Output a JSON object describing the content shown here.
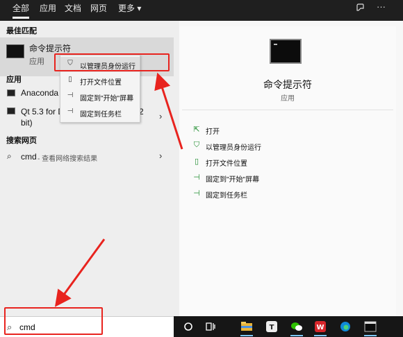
{
  "tabs": [
    {
      "label": "全部",
      "active": true
    },
    {
      "label": "应用",
      "active": false
    },
    {
      "label": "文档",
      "active": false
    },
    {
      "label": "网页",
      "active": false
    },
    {
      "label": "更多 ▾",
      "active": false
    }
  ],
  "top_icons": {
    "feedback": "♪",
    "more": "···"
  },
  "left": {
    "best_match_title": "最佳匹配",
    "best_match": {
      "name": "命令提示符",
      "type": "应用"
    },
    "apps_title": "应用",
    "apps": [
      {
        "name": "Anaconda"
      },
      {
        "name_line1": "Qt 5.3 for D",
        "name_line1_suffix": "2",
        "name_line2": "bit)"
      }
    ],
    "web_title": "搜索网页",
    "web_result": {
      "query": "cmd",
      "suffix": " - 查看网络搜索结果"
    }
  },
  "context_menu": [
    {
      "icon": "shield-run-icon",
      "glyph": "⛉",
      "label": "以管理员身份运行"
    },
    {
      "icon": "folder-open-icon",
      "glyph": "▯",
      "label": "打开文件位置"
    },
    {
      "icon": "pin-icon",
      "glyph": "⊣",
      "label": "固定到\"开始\"屏幕"
    },
    {
      "icon": "pin-icon",
      "glyph": "⊣",
      "label": "固定到任务栏"
    }
  ],
  "right": {
    "app_name": "命令提示符",
    "app_type": "应用",
    "actions": [
      {
        "icon": "open-icon",
        "glyph": "⇱",
        "label": "打开"
      },
      {
        "icon": "shield-run-icon",
        "glyph": "⛉",
        "label": "以管理员身份运行"
      },
      {
        "icon": "folder-open-icon",
        "glyph": "▯",
        "label": "打开文件位置"
      },
      {
        "icon": "pin-icon",
        "glyph": "⊣",
        "label": "固定到\"开始\"屏幕"
      },
      {
        "icon": "pin-icon",
        "glyph": "⊣",
        "label": "固定到任务栏"
      }
    ]
  },
  "search": {
    "value": "cmd"
  },
  "colors": {
    "annotation_red": "#e8231e",
    "action_green": "#1e8c2e",
    "taskbar": "#161616"
  }
}
